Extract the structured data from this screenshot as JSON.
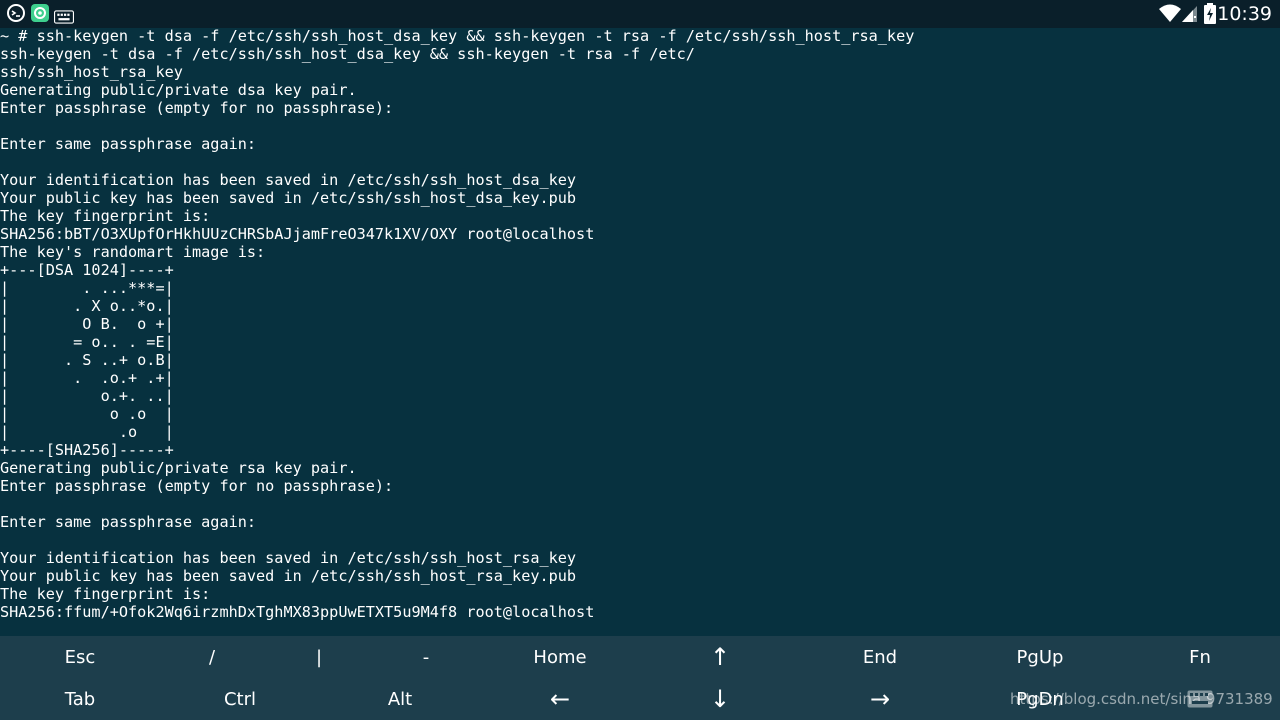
{
  "status_bar": {
    "time": "10:39",
    "notifications": [
      "terminal-notification-icon",
      "app-notification-icon",
      "keyboard-notification-icon"
    ],
    "system_icons": [
      "wifi-icon",
      "signal-icon",
      "battery-icon"
    ],
    "accent": "#ffffff"
  },
  "terminal": {
    "background": "#07313f",
    "foreground": "#ffffff",
    "lines": [
      "~ # ssh-keygen -t dsa -f /etc/ssh/ssh_host_dsa_key && ssh-keygen -t rsa -f /etc/ssh/ssh_host_rsa_key",
      "ssh-keygen -t dsa -f /etc/ssh/ssh_host_dsa_key && ssh-keygen -t rsa -f /etc/",
      "ssh/ssh_host_rsa_key",
      "Generating public/private dsa key pair.",
      "Enter passphrase (empty for no passphrase):",
      "",
      "Enter same passphrase again:",
      "",
      "Your identification has been saved in /etc/ssh/ssh_host_dsa_key",
      "Your public key has been saved in /etc/ssh/ssh_host_dsa_key.pub",
      "The key fingerprint is:",
      "SHA256:bBT/O3XUpfOrHkhUUzCHRSbAJjamFreO347k1XV/OXY root@localhost",
      "The key's randomart image is:",
      "+---[DSA 1024]----+",
      "|        . ...***=|",
      "|       . X o..*o.|",
      "|        O B.  o +|",
      "|       = o.. . =E|",
      "|      . S ..+ o.B|",
      "|       .  .o.+ .+|",
      "|          o.+. ..|",
      "|           o .o  |",
      "|            .o   |",
      "+----[SHA256]-----+",
      "Generating public/private rsa key pair.",
      "Enter passphrase (empty for no passphrase):",
      "",
      "Enter same passphrase again:",
      "",
      "Your identification has been saved in /etc/ssh/ssh_host_rsa_key",
      "Your public key has been saved in /etc/ssh/ssh_host_rsa_key.pub",
      "The key fingerprint is:",
      "SHA256:ffum/+Ofok2Wq6irzmhDxTghMX83ppUwETXT5u9M4f8 root@localhost"
    ]
  },
  "extra_keys": {
    "background": "#1d3e4c",
    "rows": [
      [
        {
          "label": "Esc",
          "icon": ""
        },
        {
          "label": "/",
          "icon": ""
        },
        {
          "label": "|",
          "icon": ""
        },
        {
          "label": "-",
          "icon": ""
        },
        {
          "label": "Home",
          "icon": ""
        },
        {
          "label": "↑",
          "icon": "arrow-up-icon"
        },
        {
          "label": "End",
          "icon": ""
        },
        {
          "label": "PgUp",
          "icon": ""
        },
        {
          "label": "Fn",
          "icon": ""
        }
      ],
      [
        {
          "label": "Tab",
          "icon": ""
        },
        {
          "label": "Ctrl",
          "icon": ""
        },
        {
          "label": "Alt",
          "icon": ""
        },
        {
          "label": "←",
          "icon": "arrow-left-icon"
        },
        {
          "label": "↓",
          "icon": "arrow-down-icon"
        },
        {
          "label": "→",
          "icon": "arrow-right-icon"
        },
        {
          "label": "PgDn",
          "icon": ""
        }
      ]
    ]
  },
  "watermark": {
    "text": "https://blog.csdn.net/sina  9731389"
  }
}
